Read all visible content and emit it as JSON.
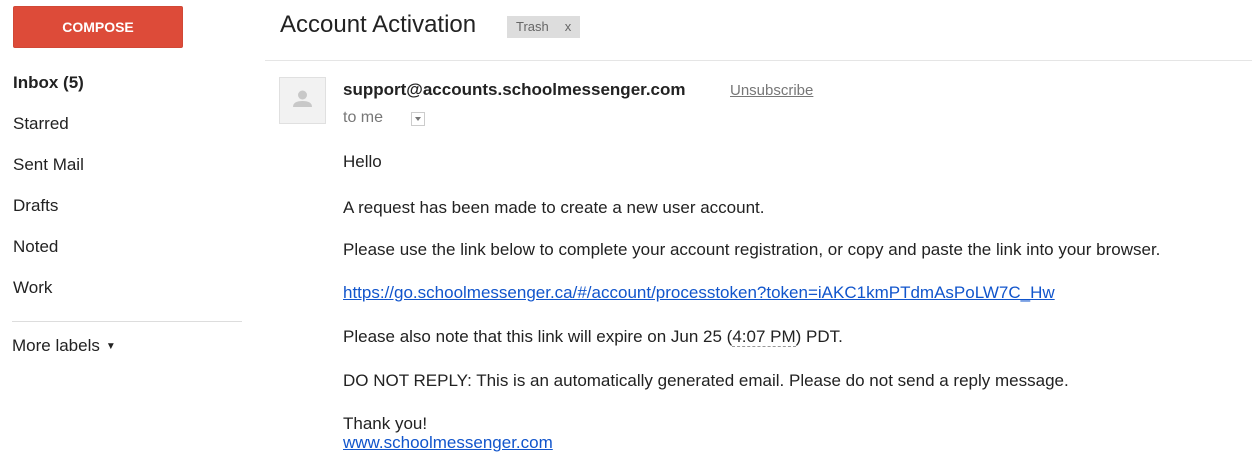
{
  "compose_label": "COMPOSE",
  "nav": {
    "inbox": "Inbox (5)",
    "starred": "Starred",
    "sent": "Sent Mail",
    "drafts": "Drafts",
    "noted": "Noted",
    "work": "Work",
    "more_labels": "More labels"
  },
  "email": {
    "subject": "Account Activation",
    "label_chip": "Trash",
    "label_remove": "x",
    "sender": "support@accounts.schoolmessenger.com",
    "unsubscribe": "Unsubscribe",
    "to": "to me",
    "body": {
      "greeting": "Hello",
      "line1": "A request has been made to create a new user account.",
      "line2": "Please use the link below to complete your account registration, or copy and paste the link into your browser.",
      "link": "https://go.schoolmessenger.ca/#/account/processtoken?token=iAKC1kmPTdmAsPoLW7C_Hw",
      "expire_prefix": "Please also note that this link will expire on Jun 25 (",
      "expire_time": "4:07 PM",
      "expire_suffix": ") PDT.",
      "no_reply": "DO NOT REPLY: This is an automatically generated email. Please do not send a reply message.",
      "thanks": "Thank you!",
      "site": "www.schoolmessenger.com"
    }
  },
  "colors": {
    "compose_bg": "#dd4b39",
    "link": "#1155cc"
  }
}
